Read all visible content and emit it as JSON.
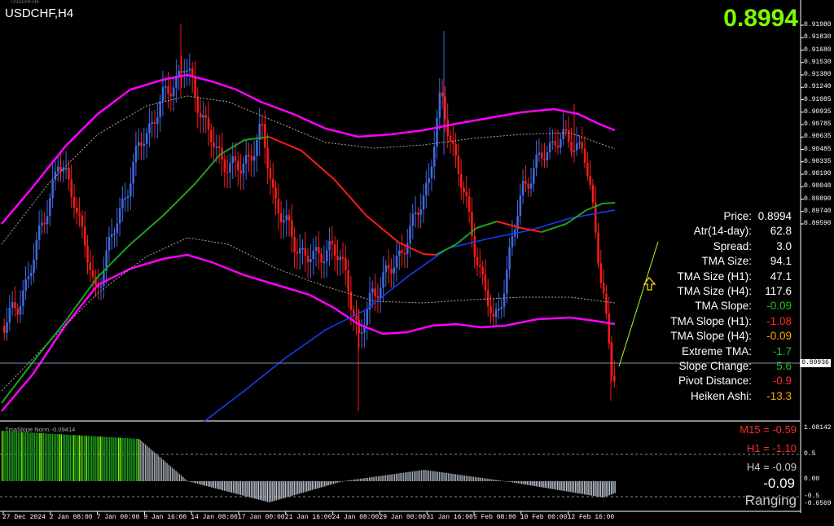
{
  "header": {
    "symbol": "USDCHF,H4",
    "tiny_name": "USDCHF,H4",
    "current_price_big": "0.8994"
  },
  "info_panel": [
    {
      "label": "Price:",
      "value": "0.8994",
      "color": "#ffffff"
    },
    {
      "label": "Atr(14-day):",
      "value": "62.8",
      "color": "#ffffff"
    },
    {
      "label": "Spread:",
      "value": "3.0",
      "color": "#ffffff"
    },
    {
      "label": "TMA Size:",
      "value": "94.1",
      "color": "#ffffff"
    },
    {
      "label": "TMA Size (H1):",
      "value": "47.1",
      "color": "#ffffff"
    },
    {
      "label": "TMA Size (H4):",
      "value": "117.6",
      "color": "#ffffff"
    },
    {
      "label": "TMA Slope:",
      "value": "-0.09",
      "color": "#1fc41f"
    },
    {
      "label": "TMA Slope (H1):",
      "value": "-1.08",
      "color": "#ff2a2a"
    },
    {
      "label": "TMA Slope (H4):",
      "value": "-0.09",
      "color": "#ffa500"
    },
    {
      "label": "Extreme TMA:",
      "value": "-1.7",
      "color": "#1fc41f"
    },
    {
      "label": "Slope Change:",
      "value": "5.6",
      "color": "#1fc41f"
    },
    {
      "label": "Pivot Distance:",
      "value": "-0.9",
      "color": "#ff2a2a"
    },
    {
      "label": "Heiken Ashi:",
      "value": "-13.3",
      "color": "#ffa500"
    }
  ],
  "price_axis": [
    "0.91980",
    "0.91830",
    "0.91680",
    "0.91530",
    "0.91380",
    "0.91240",
    "0.91085",
    "0.90935",
    "0.90785",
    "0.90635",
    "0.90485",
    "0.90335",
    "0.90190",
    "0.90040",
    "0.89890",
    "0.89740",
    "0.89590"
  ],
  "current_price_box": "0.89936",
  "time_axis": [
    "27 Dec 2024",
    "2 Jan 08:00",
    "7 Jan 00:00",
    "9 Jan 16:00",
    "14 Jan 08:00",
    "17 Jan 00:00",
    "21 Jan 16:00",
    "24 Jan 08:00",
    "29 Jan 00:00",
    "31 Jan 16:00",
    "5 Feb 08:00",
    "10 Feb 00:00",
    "12 Feb 16:00"
  ],
  "indicator": {
    "title": "TmaSlope Norm -0.09414",
    "axis": [
      "1.08142",
      "0.5",
      "0.00",
      "-0.5",
      "-0.6569"
    ],
    "m15": "M15 = -0.59",
    "h1": "H1 = -1.10",
    "h4": "H4 = -0.09",
    "big_value": "-0.09",
    "state": "Ranging",
    "colors": {
      "m15": "#ff2a2a",
      "h1": "#ff2a2a",
      "h4": "#cccccc"
    }
  },
  "colors": {
    "bull": "#4169e1",
    "bear": "#ff1a1a",
    "band": "#ff00ff",
    "tma_up": "#1fa01f",
    "tma_down": "#ff1a1a",
    "ma_blue": "#1a3cff",
    "price_green": "#7cfc00"
  }
}
